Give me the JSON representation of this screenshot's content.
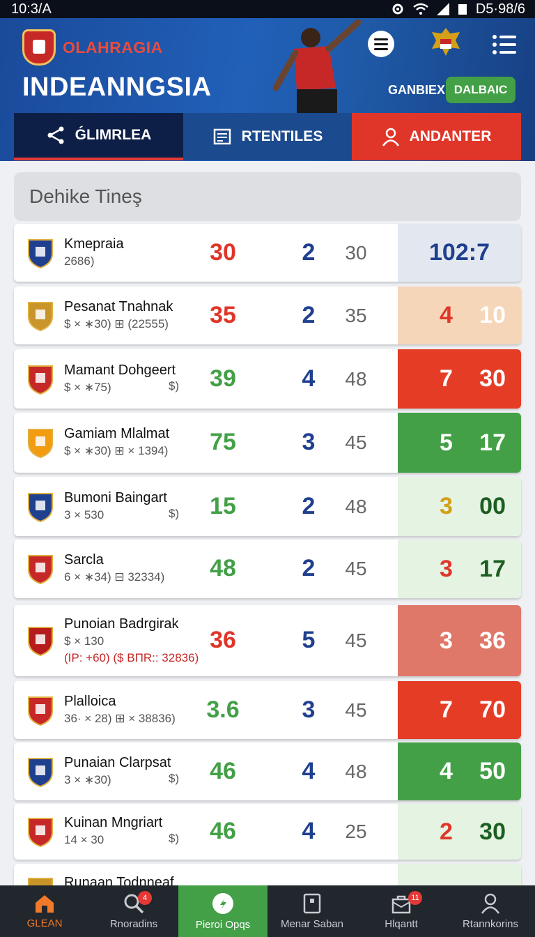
{
  "status_bar": {
    "time": "10:3/A",
    "right_text": "D5·98/6"
  },
  "header": {
    "brand_name": "OLAHRAGIA",
    "app_title": "INDEANNGSIA",
    "season_label": "GANBIEX",
    "season_button": "DALBAIC"
  },
  "tabs": [
    {
      "label": "ǴLIMRLEA",
      "icon": "share-icon"
    },
    {
      "label": "RTENTILES",
      "icon": "document-icon"
    },
    {
      "label": "ANDANTER",
      "icon": "user-icon"
    }
  ],
  "section_title": "Dehike Tineş",
  "rows": [
    {
      "name": "Kmepraia",
      "sub": "2686)",
      "sub2": "",
      "coin": "",
      "a": "30",
      "a_color": "#e0362a",
      "b": "2",
      "c": "30",
      "score_single": "102:7",
      "s1": "",
      "s2": "",
      "s1_color": "",
      "s2_color": "#1f3f8f",
      "box_bg": "#e3e8f0",
      "crest_color": "#1f3f8f"
    },
    {
      "name": "Pesanat Tnahnak",
      "sub": "$ × ∗30) ⊞ (22555)",
      "sub2": "",
      "coin": "",
      "a": "35",
      "a_color": "#e0362a",
      "b": "2",
      "c": "35",
      "score_single": "",
      "s1": "4",
      "s2": "10",
      "s1_color": "#e0362a",
      "s2_color": "#ffffff",
      "box_bg": "#f5d6b8",
      "crest_color": "#c9952a"
    },
    {
      "name": "Mamant Dohgeert",
      "sub": "$ × ∗75)",
      "sub2": "",
      "coin": "$)",
      "a": "39",
      "a_color": "#43a047",
      "b": "4",
      "c": "48",
      "score_single": "",
      "s1": "7",
      "s2": "30",
      "s1_color": "#ffffff",
      "s2_color": "#ffffff",
      "box_bg": "#e53c26",
      "crest_color": "#c62828"
    },
    {
      "name": "Gamiam Mlalmat",
      "sub": "$ × ∗30) ⊞ × 1394)",
      "sub2": "",
      "coin": "",
      "a": "75",
      "a_color": "#43a047",
      "b": "3",
      "c": "45",
      "score_single": "",
      "s1": "5",
      "s2": "17",
      "s1_color": "#ffffff",
      "s2_color": "#ffffff",
      "box_bg": "#43a047",
      "crest_color": "#f39c12"
    },
    {
      "name": "Bumoni Baingart",
      "sub": "3 × 530",
      "sub2": "",
      "coin": "$)",
      "a": "15",
      "a_color": "#43a047",
      "b": "2",
      "c": "48",
      "score_single": "",
      "s1": "3",
      "s2": "00",
      "s1_color": "#d4a017",
      "s2_color": "#1b5e20",
      "box_bg": "#e5f3e3",
      "crest_color": "#1f3f8f"
    },
    {
      "name": "Sarcla",
      "sub": "6 × ∗34) ⊟ 32334)",
      "sub2": "",
      "coin": "",
      "a": "48",
      "a_color": "#43a047",
      "b": "2",
      "c": "45",
      "score_single": "",
      "s1": "3",
      "s2": "17",
      "s1_color": "#e0362a",
      "s2_color": "#1b5e20",
      "box_bg": "#e5f3e3",
      "crest_color": "#c62828"
    },
    {
      "name": "Punoian Badrgirak",
      "sub": "$ × 130",
      "sub2": "(IP: +60) ($ ΒΠR:: 32836)",
      "coin": "",
      "a": "36",
      "a_color": "#e0362a",
      "b": "5",
      "c": "45",
      "score_single": "",
      "s1": "3",
      "s2": "36",
      "s1_color": "#ffffff",
      "s2_color": "#ffffff",
      "box_bg": "#e0786a",
      "crest_color": "#b71c1c"
    },
    {
      "name": "Plalloica",
      "sub": "36· × 28) ⊞ × 38836)",
      "sub2": "",
      "coin": "",
      "a": "3.6",
      "a_color": "#43a047",
      "b": "3",
      "c": "45",
      "score_single": "",
      "s1": "7",
      "s2": "70",
      "s1_color": "#ffffff",
      "s2_color": "#ffffff",
      "box_bg": "#e53c26",
      "crest_color": "#c62828"
    },
    {
      "name": "Punaian Clarpsat",
      "sub": "3 × ∗30)",
      "sub2": "",
      "coin": "$)",
      "a": "46",
      "a_color": "#43a047",
      "b": "4",
      "c": "48",
      "score_single": "",
      "s1": "4",
      "s2": "50",
      "s1_color": "#ffffff",
      "s2_color": "#ffffff",
      "box_bg": "#43a047",
      "crest_color": "#1f3f8f"
    },
    {
      "name": "Kuinan Mngriart",
      "sub": "14 × 30",
      "sub2": "",
      "coin": "$)",
      "a": "46",
      "a_color": "#43a047",
      "b": "4",
      "c": "25",
      "score_single": "",
      "s1": "2",
      "s2": "30",
      "s1_color": "#e0362a",
      "s2_color": "#1b5e20",
      "box_bg": "#e5f3e3",
      "crest_color": "#c62828"
    },
    {
      "name": "Runaan Todnneaf",
      "sub": "",
      "sub2": "",
      "coin": "",
      "a": "",
      "a_color": "#e0362a",
      "b": "",
      "c": "",
      "score_single": "",
      "s1": "",
      "s2": "",
      "s1_color": "#e0362a",
      "s2_color": "#1b5e20",
      "box_bg": "#e5f3e3",
      "crest_color": "#c9952a"
    }
  ],
  "bottom_nav": [
    {
      "label": "GLEAN",
      "icon": "home-icon",
      "badge": ""
    },
    {
      "label": "Rnoradins",
      "icon": "search-icon",
      "badge": "4"
    },
    {
      "label": "Pieroi Opqs",
      "icon": "compass-icon",
      "badge": ""
    },
    {
      "label": "Menar Saban",
      "icon": "tablet-icon",
      "badge": ""
    },
    {
      "label": "Hlqantt",
      "icon": "bag-icon",
      "badge": "11"
    },
    {
      "label": "Rtannkorins",
      "icon": "profile-icon",
      "badge": ""
    }
  ]
}
